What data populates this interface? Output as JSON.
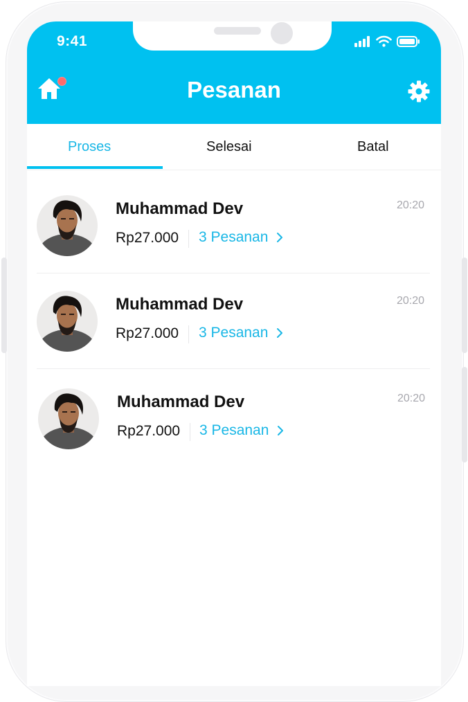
{
  "status_bar": {
    "time": "9:41"
  },
  "header": {
    "title": "Pesanan",
    "home_icon": "home-icon",
    "settings_icon": "gear-icon",
    "notification_color": "#ff6b6b"
  },
  "tabs": [
    {
      "label": "Proses",
      "active": true
    },
    {
      "label": "Selesai",
      "active": false
    },
    {
      "label": "Batal",
      "active": false
    }
  ],
  "orders": [
    {
      "name": "Muhammad Dev",
      "price": "Rp27.000",
      "orders_label": "3 Pesanan",
      "time": "20:20"
    },
    {
      "name": "Muhammad Dev",
      "price": "Rp27.000",
      "orders_label": "3 Pesanan",
      "time": "20:20"
    },
    {
      "name": "Muhammad Dev",
      "price": "Rp27.000",
      "orders_label": "3 Pesanan",
      "time": "20:20"
    }
  ],
  "colors": {
    "primary": "#00c1f0",
    "accent_text": "#19b7e6",
    "muted_text": "#a7a7ad"
  }
}
